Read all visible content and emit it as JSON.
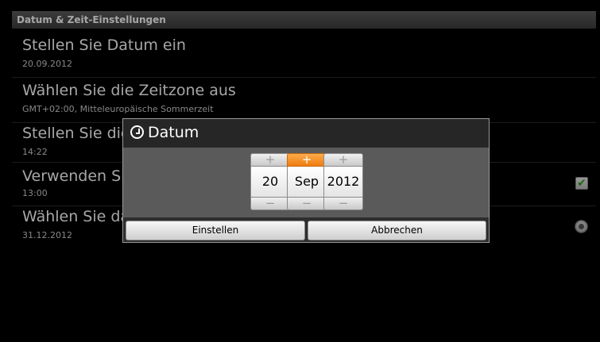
{
  "header": {
    "title": "Datum & Zeit-Einstellungen"
  },
  "settings": [
    {
      "title": "Stellen Sie Datum ein",
      "subtitle": "20.09.2012"
    },
    {
      "title": "Wählen Sie die Zeitzone aus",
      "subtitle": "GMT+02:00, Mitteleuropäische Sommerzeit"
    },
    {
      "title": "Stellen Sie die Uhrzeit ein",
      "subtitle": "14:22"
    },
    {
      "title": "Verwenden Sie 24-Stunden-Format",
      "subtitle": "13:00",
      "control": "checkbox",
      "checked": true
    },
    {
      "title": "Wählen Sie das Datumsformat aus",
      "subtitle": "31.12.2012",
      "control": "radio"
    }
  ],
  "dialog": {
    "title": "Datum",
    "icon": "clock-icon",
    "pickers": [
      {
        "value": "20",
        "plus": "+",
        "minus": "−",
        "selected": false
      },
      {
        "value": "Sep",
        "plus": "+",
        "minus": "−",
        "selected": true
      },
      {
        "value": "2012",
        "plus": "+",
        "minus": "−",
        "selected": false
      }
    ],
    "set_label": "Einstellen",
    "cancel_label": "Abbrechen"
  },
  "colors": {
    "accent": "#f07c10",
    "background": "#000000"
  }
}
